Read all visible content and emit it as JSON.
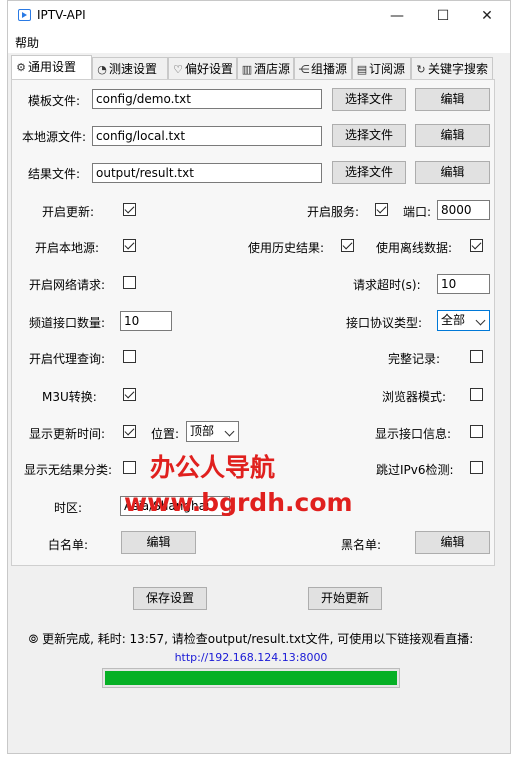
{
  "window": {
    "title": "IPTV-API",
    "minimize": "—",
    "maximize": "☐",
    "close": "✕"
  },
  "menu": {
    "help": "帮助"
  },
  "tabs": [
    {
      "label": "通用设置",
      "icon": "gear-icon",
      "glyph": "⚙"
    },
    {
      "label": "测速设置",
      "icon": "speed-icon",
      "glyph": "◔"
    },
    {
      "label": "偏好设置",
      "icon": "heart-icon",
      "glyph": "♡"
    },
    {
      "label": "酒店源",
      "icon": "building-icon",
      "glyph": "▥"
    },
    {
      "label": "组播源",
      "icon": "network-icon",
      "glyph": "⋲"
    },
    {
      "label": "订阅源",
      "icon": "subscribe-icon",
      "glyph": "▤"
    },
    {
      "label": "关键字搜索",
      "icon": "refresh-search-icon",
      "glyph": "↻"
    }
  ],
  "general": {
    "template_label": "模板文件:",
    "template_value": "config/demo.txt",
    "local_label": "本地源文件:",
    "local_value": "config/local.txt",
    "result_label": "结果文件:",
    "result_value": "output/result.txt",
    "choose_file": "选择文件",
    "edit": "编辑",
    "open_update": "开启更新:",
    "open_update_checked": true,
    "open_service": "开启服务:",
    "open_service_checked": true,
    "port_label": "端口:",
    "port_value": "8000",
    "open_local": "开启本地源:",
    "open_local_checked": true,
    "use_history": "使用历史结果:",
    "use_history_checked": true,
    "use_offline": "使用离线数据:",
    "use_offline_checked": true,
    "open_request": "开启网络请求:",
    "open_request_checked": false,
    "request_timeout": "请求超时(s):",
    "request_timeout_value": "10",
    "channel_count": "频道接口数量:",
    "channel_count_value": "10",
    "protocol_label": "接口协议类型:",
    "protocol_value": "全部",
    "open_proxy": "开启代理查询:",
    "open_proxy_checked": false,
    "full_log": "完整记录:",
    "full_log_checked": false,
    "m3u": "M3U转换:",
    "m3u_checked": true,
    "browser_mode": "浏览器模式:",
    "browser_mode_checked": false,
    "show_update_time": "显示更新时间:",
    "show_update_time_checked": true,
    "position_label": "位置:",
    "position_value": "顶部",
    "show_url_info": "显示接口信息:",
    "show_url_info_checked": false,
    "show_no_result": "显示无结果分类:",
    "show_no_result_checked": false,
    "skip_ipv6": "跳过IPv6检测:",
    "skip_ipv6_checked": false,
    "timezone_label": "时区:",
    "timezone_value": "Asia/Shanghai",
    "whitelist_label": "白名单:",
    "blacklist_label": "黑名单:"
  },
  "actions": {
    "save": "保存设置",
    "start": "开始更新"
  },
  "status": {
    "icon": "check-circle-icon",
    "text": "更新完成, 耗时: 13:57, 请检查output/result.txt文件, 可使用以下链接观看直播:",
    "url": "http://192.168.124.13:8000",
    "progress": 1.0
  },
  "watermark": {
    "line1": "办公人导航",
    "line2": "www.bgrdh.com"
  },
  "colors": {
    "progress": "#06b025",
    "watermark": "#e0201e",
    "link": "#1a1ad6"
  }
}
